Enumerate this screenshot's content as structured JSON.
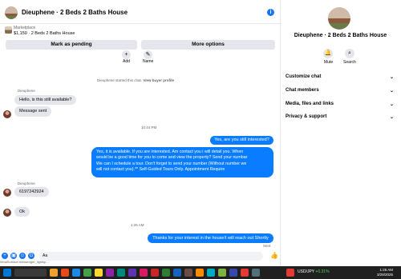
{
  "header": {
    "title": "Dieuphene · 2 Beds 2 Baths House",
    "info_icon": "i"
  },
  "marketplace": {
    "label": "Marketplace",
    "listing": "$1,150 · 2 Beds 2 Baths House"
  },
  "actions": {
    "mark_pending": "Mark as pending",
    "more_options": "More options"
  },
  "profile_actions": [
    {
      "label": "Add",
      "icon": "add-person-icon"
    },
    {
      "label": "Name",
      "icon": "pencil-icon"
    }
  ],
  "notice": {
    "text": "Dieuphene started this chat.",
    "link": "View buyer profile"
  },
  "messages": {
    "sender1": "Dieuphene",
    "m1": "Hello, is this still available?",
    "m2": "Message sent",
    "time1": "10:44 PM",
    "out1": "Yes, are you still interested?",
    "out2_lines": [
      "Yes, it is available. If you are interested.  Am contact you i will detail you.  When",
      "would be a good time for you to come and view the property? Send your numbar",
      "We can I schedule a tour.  Don't forget to send your number (Without number we",
      "will not contact you).** Self-Guided Tours Only. Appointment Require"
    ],
    "sender2": "Dieuphene",
    "m3": "6197242924",
    "m4": "Ok",
    "time2": "1:26 AM",
    "out3": "Thanks for your interest in the house!I will reach out Shortly",
    "status": "Sent"
  },
  "composer": {
    "value": "Aa",
    "url": "/feralSurface:messenger_lightsp..."
  },
  "panel": {
    "title": "Dieuphene · 2 Beds 2 Baths House",
    "mute": "Mute",
    "search": "Search",
    "sections": [
      "Customize chat",
      "Chat members",
      "Media, files and links",
      "Privacy & support"
    ]
  },
  "taskbar": {
    "ticker": "USD/JPY",
    "change": "+0.31%",
    "time": "1:26 AM",
    "date": "3/28/2025"
  },
  "colors": {
    "accent": "#1877f2",
    "bubble_out": "#0a7cff",
    "bubble_in": "#e4e6eb"
  }
}
